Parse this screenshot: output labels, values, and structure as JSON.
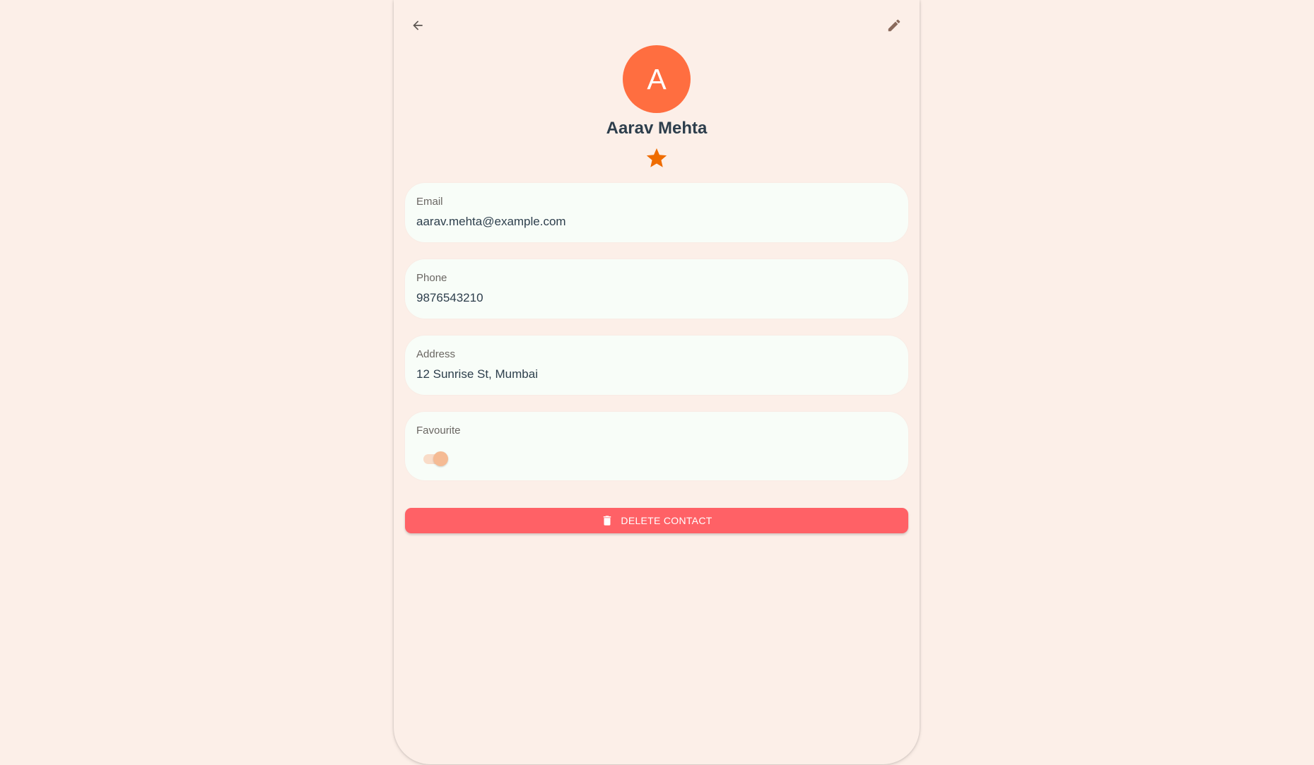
{
  "contact": {
    "avatar_letter": "A",
    "name": "Aarav Mehta",
    "favourite_star_icon": "star-icon"
  },
  "header": {
    "back_icon": "arrow-back-icon",
    "edit_icon": "pencil-icon"
  },
  "fields": {
    "email": {
      "label": "Email",
      "value": "aarav.mehta@example.com"
    },
    "phone": {
      "label": "Phone",
      "value": "9876543210"
    },
    "address": {
      "label": "Address",
      "value": "12 Sunrise St, Mumbai"
    },
    "favourite": {
      "label": "Favourite",
      "on": true
    }
  },
  "actions": {
    "delete_label": "DELETE CONTACT",
    "delete_icon": "trash-icon"
  },
  "colors": {
    "background": "#fcefe8",
    "avatar": "#ff6e40",
    "star": "#ef6c00",
    "card": "#f8fdf8",
    "delete_button": "#ff6166",
    "text_primary": "#2d3e4c",
    "text_label": "#6a6662"
  }
}
